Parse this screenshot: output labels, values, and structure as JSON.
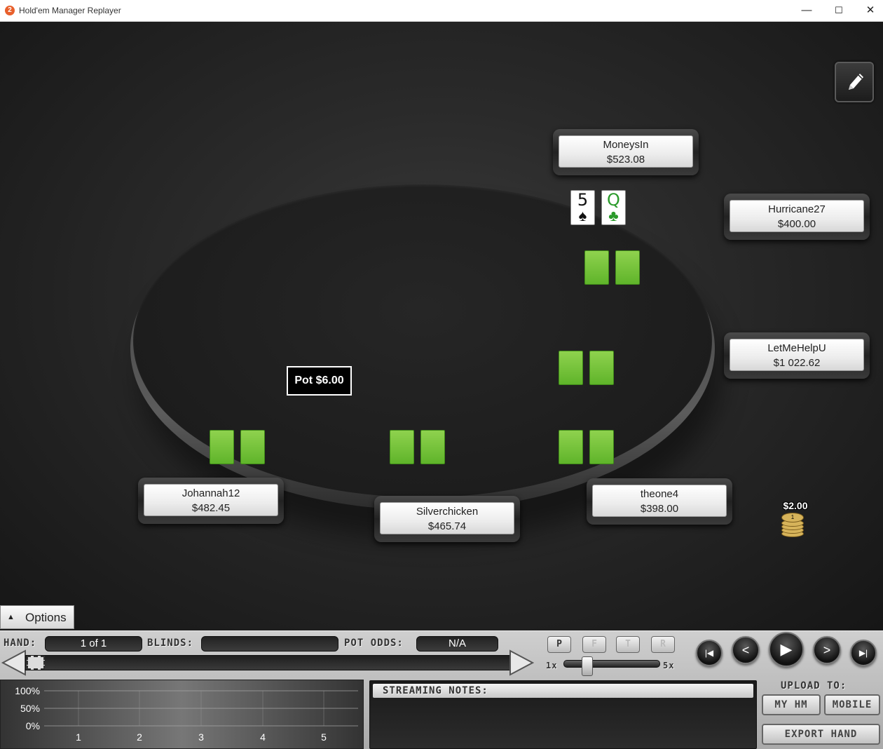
{
  "window": {
    "title": "Hold'em Manager Replayer",
    "icon_text": "2",
    "minimize": "—",
    "maximize": "☐",
    "close": "✕"
  },
  "players": [
    {
      "name": "MoneysIn",
      "stack": "$523.08"
    },
    {
      "name": "Hurricane27",
      "stack": "$400.00"
    },
    {
      "name": "LetMeHelpU",
      "stack": "$1 022.62"
    },
    {
      "name": "theone4",
      "stack": "$398.00"
    },
    {
      "name": "Silverchicken",
      "stack": "$465.74"
    },
    {
      "name": "Johannah12",
      "stack": "$482.45"
    }
  ],
  "hero_cards": [
    {
      "rank": "5",
      "suit": "♠",
      "color": "#111111"
    },
    {
      "rank": "Q",
      "suit": "♣",
      "color": "#2a9a2a"
    }
  ],
  "pot": "Pot $6.00",
  "bet_chip": "$2.00",
  "bet_chip_denomination": "1",
  "options_label": "Options",
  "controls": {
    "hand_label": "HAND:",
    "hand_value": "1 of 1",
    "blinds_label": "BLINDS:",
    "blinds_value": "",
    "pot_odds_label": "POT ODDS:",
    "pot_odds_value": "N/A",
    "streets": [
      "P",
      "F",
      "T",
      "R"
    ],
    "speed_min": "1x",
    "speed_max": "5x",
    "transport": [
      "|◀",
      "<",
      "▶",
      ">",
      "▶|"
    ]
  },
  "equity_chart": {
    "y_labels": [
      "100%",
      "50%",
      "0%"
    ],
    "x_labels": [
      "1",
      "2",
      "3",
      "4",
      "5"
    ]
  },
  "notes": {
    "label": "STREAMING NOTES:"
  },
  "upload": {
    "label": "UPLOAD TO:",
    "my_hm": "MY HM",
    "mobile": "MOBILE",
    "export": "EXPORT HAND"
  },
  "colors": {
    "card_back": "#6fc23a",
    "table": "#1e1e1e",
    "accent": "#e8602c"
  }
}
